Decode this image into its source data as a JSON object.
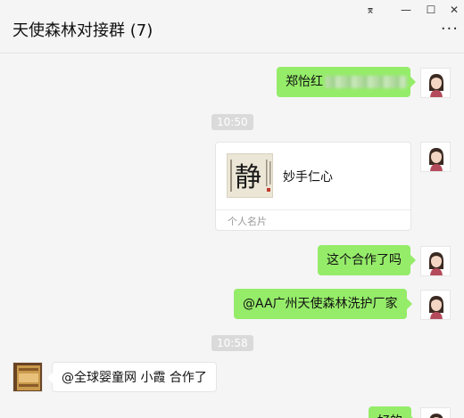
{
  "window": {
    "title": "天使森林对接群 (7)",
    "pin_glyph": "⌆",
    "minimize_glyph": "—",
    "maximize_glyph": "☐",
    "close_glyph": "✕",
    "more_glyph": "···"
  },
  "messages": {
    "m1_text": "郑怡红",
    "t1": "10:50",
    "card_name": "妙手仁心",
    "card_label": "个人名片",
    "card_image_char": "静",
    "m3_text": "这个合作了吗",
    "m4_text": "@AA广州天使森林洗护厂家",
    "t2": "10:58",
    "m5_text": "@全球婴童网 小霞 合作了",
    "m6_text": "好的"
  },
  "colors": {
    "self_bubble": "#95ec69",
    "other_bubble": "#ffffff",
    "timestamp_bg": "#dadada"
  }
}
